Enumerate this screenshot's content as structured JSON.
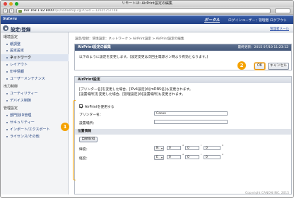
{
  "window": {
    "title": "リモートUI: AirPrint設定の編集",
    "address_host": "192.168.1.82:8000",
    "address_rest": "/rps/nativetop.cgi?CSRT=-12655757748"
  },
  "colors": {
    "header_bg": "#2a4b96",
    "panel_head_bg": "#4f6386",
    "callout": "#f5a200"
  },
  "app_header": {
    "brand": "Satera",
    "portal_link": "ポータル",
    "login_user": "ログインユーザー：管理者 ログアウト"
  },
  "page_header": {
    "icon": "gear-icon",
    "title": "設定/登録",
    "admin_link": "管理者メール"
  },
  "sidebar": {
    "items": [
      {
        "label": "環境設定",
        "type": "group"
      },
      {
        "label": "紙調整",
        "type": "item"
      },
      {
        "label": "設定設定",
        "type": "item"
      },
      {
        "label": "ネットワーク",
        "type": "active"
      },
      {
        "label": "レイアウト",
        "type": "item"
      },
      {
        "label": "印字情報",
        "type": "item"
      },
      {
        "label": "ユーザーメンテナンス",
        "type": "item"
      },
      {
        "label": "出力制御",
        "type": "group"
      },
      {
        "label": "ユーティリティー",
        "type": "item"
      },
      {
        "label": "デバイス制御",
        "type": "item"
      },
      {
        "label": "管理設定",
        "type": "group"
      },
      {
        "label": "部門別ID管理",
        "type": "item"
      },
      {
        "label": "セキュリティー",
        "type": "item"
      },
      {
        "label": "インポート/エクスポート",
        "type": "item"
      },
      {
        "label": "ライセンス/その他",
        "type": "item"
      }
    ]
  },
  "breadcrumb": "設定/登録：環境設定：ネットワーク > AirPrint設定 > AirPrint設定の編集",
  "edit_panel": {
    "title": "AirPrint設定の編集",
    "timestamp": "最終更新：2015 07/10 11:23:12",
    "message": "以下のように設定を変更します。(設定変更は次回主電源オン時より有効となります。)",
    "ok_label": "OK",
    "cancel_label": "キャンセル",
    "callout_ok": "2"
  },
  "settings_panel": {
    "title": "AirPrint設定",
    "note_line1": "[プリンター名]を変更した場合、[IPv4設定]の[mDNS名]も変更されます。",
    "note_line2": "[設置場所]を変更した場合、[管理設定]の[設置場所]も変更されます。",
    "enable_label": "AirPrintを使用する",
    "enable_checked": true,
    "printer_name_label": "プリンター名：",
    "printer_name_value": "Canon",
    "location_label": "設置場所：",
    "location_value": "",
    "geo_section_title": "位置情報",
    "geo_button_label": "自動取得",
    "latitude_label": "緯度：",
    "latitude_dir": "N",
    "latitude_deg": "0",
    "latitude_min": "0",
    "latitude_sec": "0",
    "longitude_label": "経度：",
    "longitude_dir": "E",
    "longitude_deg": "0",
    "longitude_min": "0",
    "longitude_sec": "0",
    "unit_deg": "°",
    "unit_min": "'",
    "unit_sec": "\"",
    "callout": "1"
  },
  "footer": "Copyright CANON INC. 2015"
}
